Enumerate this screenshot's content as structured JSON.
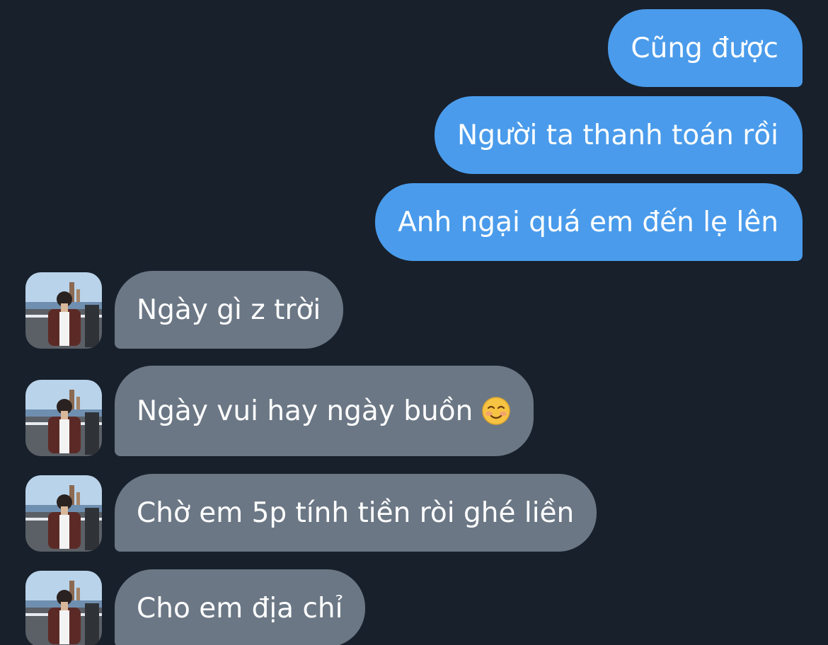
{
  "messages": [
    {
      "direction": "outgoing",
      "text": "Cũng được"
    },
    {
      "direction": "outgoing",
      "text": "Người ta thanh toán rồi"
    },
    {
      "direction": "outgoing",
      "text": "Anh ngại quá em đến lẹ lên"
    },
    {
      "direction": "incoming",
      "text": "Ngày gì z trời"
    },
    {
      "direction": "incoming",
      "text": "Ngày vui hay ngày buồn",
      "emoji": "smiling-face-icon"
    },
    {
      "direction": "incoming",
      "text": "Chờ em 5p tính tiền ròi ghé liền"
    },
    {
      "direction": "incoming",
      "text": "Cho em địa chỉ"
    }
  ],
  "colors": {
    "background": "#18202b",
    "outgoing_bubble": "#4a9beb",
    "incoming_bubble": "#6b7785",
    "text": "#ffffff"
  }
}
